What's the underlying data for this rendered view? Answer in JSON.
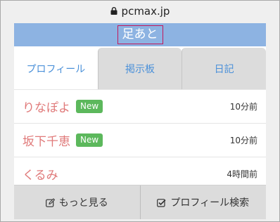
{
  "browser": {
    "url": "pcmax.jp",
    "lock_icon": "lock-icon"
  },
  "header": {
    "title": "足あと"
  },
  "tabs": [
    {
      "label": "プロフィール",
      "active": true
    },
    {
      "label": "掲示板",
      "active": false
    },
    {
      "label": "日記",
      "active": false
    }
  ],
  "rows": [
    {
      "name": "りなぽよ",
      "badge": "New",
      "time": "10分前"
    },
    {
      "name": "坂下千恵",
      "badge": "New",
      "time": "10分前"
    },
    {
      "name": "くるみ",
      "badge": "",
      "time": "4時間前"
    }
  ],
  "footer": {
    "more_label": "もっと見る",
    "more_icon": "edit-icon",
    "search_label": "プロフィール検索",
    "search_icon": "checkbox-icon"
  },
  "colors": {
    "header_bg": "#8db3e2",
    "tab_text": "#4a90d9",
    "name_text": "#e07a7a",
    "badge_bg": "#5cb85c",
    "title_border": "#c2185b"
  }
}
